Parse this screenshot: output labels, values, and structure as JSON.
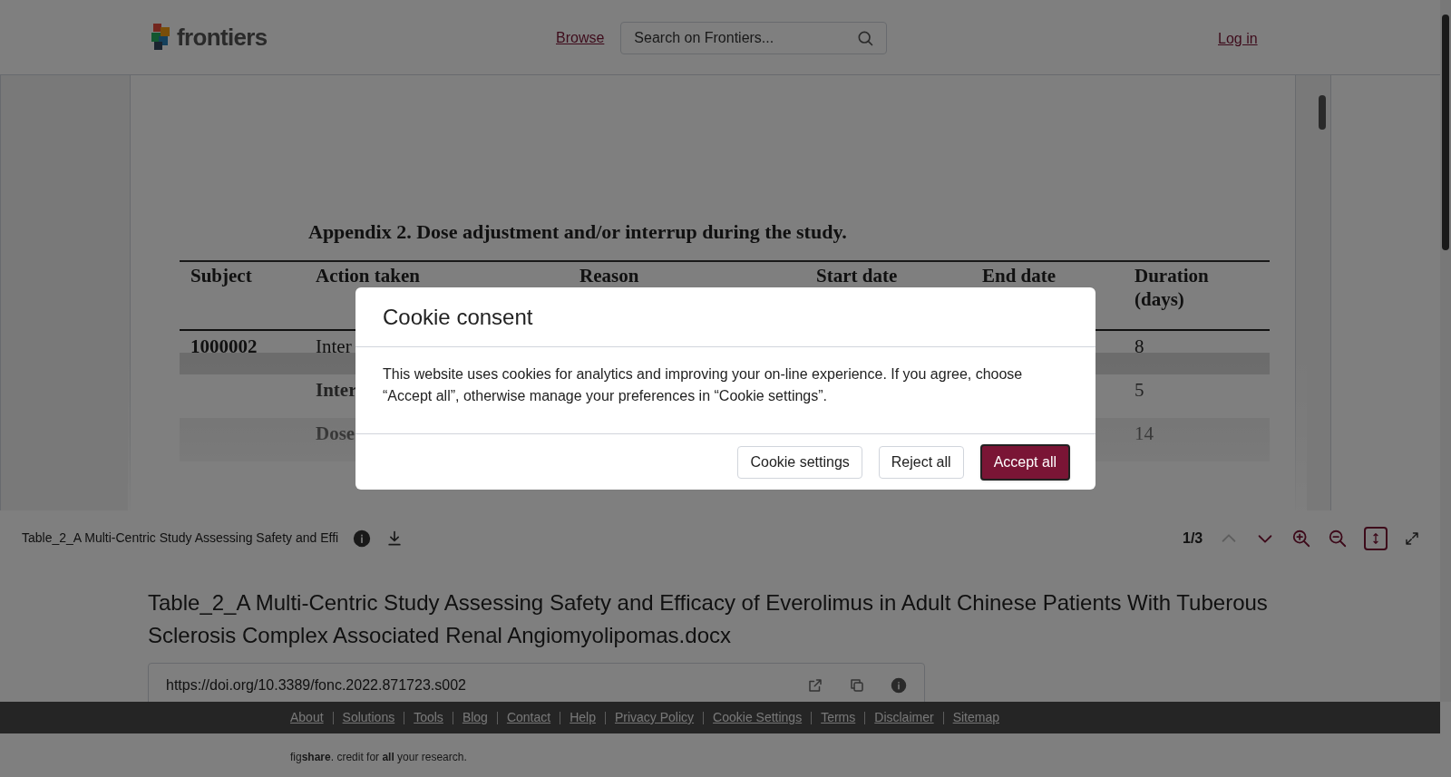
{
  "header": {
    "logo": "frontiers",
    "browse_link": "Browse",
    "search": {
      "placeholder": "Search on Frontiers..."
    },
    "login_link": "Log in"
  },
  "viewer": {
    "document": {
      "title": "Appendix 2. Dose adjustment and/or interrup during the study.",
      "columns": [
        "Subject",
        "Action taken",
        "Reason",
        "Start date",
        "End date",
        "Duration (days)"
      ],
      "rows": [
        {
          "subject": "1000002",
          "action": "Inter",
          "duration": "8"
        },
        {
          "subject": "",
          "action": "Inter",
          "duration": "5"
        },
        {
          "subject": "",
          "action": "Dose",
          "duration": "14"
        }
      ]
    },
    "toolbar": {
      "filename": "Table_2_A Multi-Centric Study Assessing Safety and Effi",
      "page": "1/3",
      "prev_disabled": true,
      "next_disabled": false,
      "fit_height_selected": true
    }
  },
  "item_title": "Table_2_A Multi-Centric Study Assessing Safety and Efficacy of Everolimus in Adult Chinese Patients With Tuberous Sclerosis Complex Associated Renal Angiomyolipomas.docx",
  "doi": "https://doi.org/10.3389/fonc.2022.871723.s002",
  "footer": {
    "links": [
      "About",
      "Solutions",
      "Tools",
      "Blog",
      "Contact",
      "Help",
      "Privacy Policy",
      "Cookie Settings",
      "Terms",
      "Disclaimer",
      "Sitemap"
    ],
    "credit": "fig**share**. credit for **all** your research."
  },
  "cookie_modal": {
    "title": "Cookie consent",
    "body": "This website uses cookies for analytics and improving your on-line experience. If you agree, choose “Accept all”, otherwise manage your preferences in “Cookie settings”.",
    "buttons": [
      {
        "label": "Cookie settings",
        "primary": false
      },
      {
        "label": "Reject all",
        "primary": false
      },
      {
        "label": "Accept all",
        "primary": true
      }
    ]
  }
}
